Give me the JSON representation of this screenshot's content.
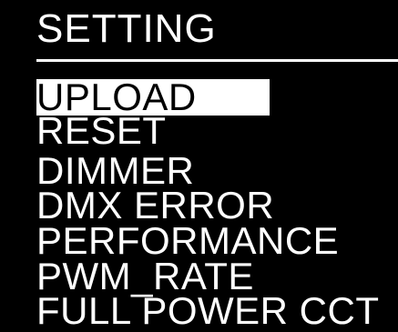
{
  "header": {
    "title": "SETTING"
  },
  "menu": {
    "selected_index": 0,
    "items": [
      {
        "label": "UPLOAD"
      },
      {
        "label": "RESET"
      },
      {
        "label": "DIMMER"
      },
      {
        "label": "DMX ERROR"
      },
      {
        "label": "PERFORMANCE"
      },
      {
        "label": "PWM_RATE"
      },
      {
        "label": "FULL POWER CCT"
      }
    ]
  },
  "colors": {
    "background": "#000000",
    "foreground": "#ffffff",
    "highlight_bg": "#ffffff",
    "highlight_text": "#000000"
  }
}
